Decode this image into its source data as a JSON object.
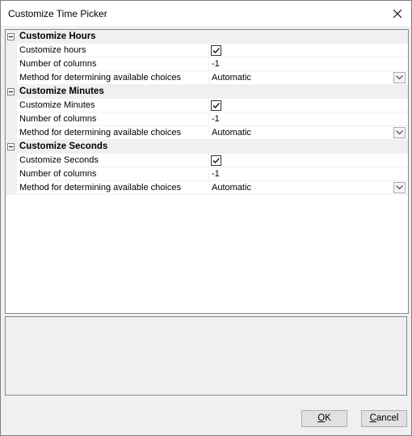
{
  "window": {
    "title": "Customize Time Picker"
  },
  "categories": [
    {
      "label": "Customize Hours",
      "rows": [
        {
          "name": "Customize hours",
          "type": "checkbox",
          "checked": true
        },
        {
          "name": "Number of columns",
          "type": "text",
          "value": "-1"
        },
        {
          "name": "Method for determining available choices",
          "type": "dropdown",
          "value": "Automatic"
        }
      ]
    },
    {
      "label": "Customize Minutes",
      "rows": [
        {
          "name": "Customize Minutes",
          "type": "checkbox",
          "checked": true
        },
        {
          "name": "Number of columns",
          "type": "text",
          "value": "-1"
        },
        {
          "name": "Method for determining available choices",
          "type": "dropdown",
          "value": "Automatic"
        }
      ]
    },
    {
      "label": "Customize Seconds",
      "rows": [
        {
          "name": "Customize Seconds",
          "type": "checkbox",
          "checked": true
        },
        {
          "name": "Number of columns",
          "type": "text",
          "value": "-1"
        },
        {
          "name": "Method for determining available choices",
          "type": "dropdown",
          "value": "Automatic"
        }
      ]
    }
  ],
  "buttons": {
    "ok": {
      "mnemonic": "O",
      "rest": "K"
    },
    "cancel": {
      "mnemonic": "C",
      "rest": "ancel"
    }
  },
  "icons": {
    "close": "close-icon",
    "dropdown": "chevron-down-icon",
    "check": "checkmark-icon",
    "collapse": "minus-icon"
  }
}
